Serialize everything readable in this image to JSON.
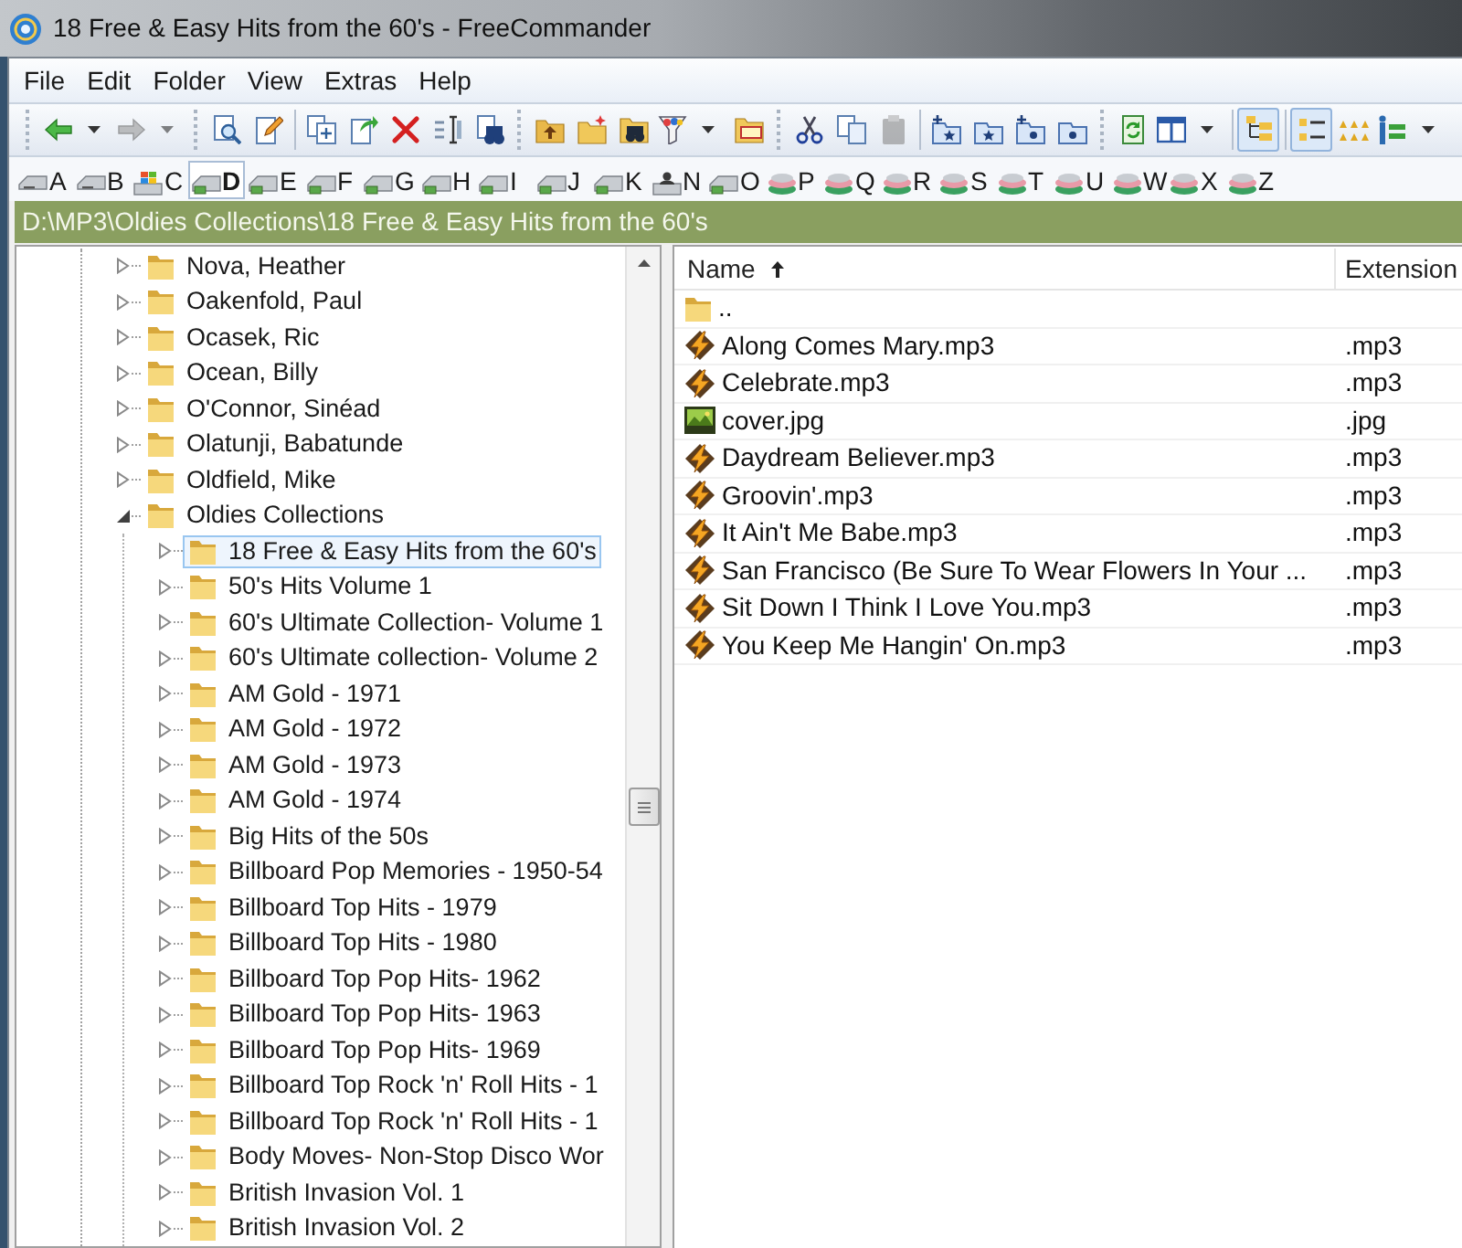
{
  "window": {
    "title": "18 Free & Easy Hits from the 60's - FreeCommander"
  },
  "menu": [
    "File",
    "Edit",
    "Folder",
    "View",
    "Extras",
    "Help"
  ],
  "toolbar": [
    {
      "pressed": false,
      "disabled": false
    },
    {
      "pressed": false,
      "disabled": true
    },
    {
      "pressed": false,
      "disabled": false
    },
    {
      "pressed": false,
      "disabled": false
    },
    {
      "pressed": false,
      "disabled": false
    },
    {
      "pressed": false,
      "disabled": false
    },
    {
      "pressed": false,
      "disabled": false
    },
    {
      "pressed": false,
      "disabled": false
    },
    {
      "pressed": false,
      "disabled": false
    },
    {
      "pressed": false,
      "disabled": false
    },
    {
      "pressed": false,
      "disabled": false
    },
    {
      "pressed": false,
      "disabled": false
    },
    {
      "pressed": false,
      "disabled": false
    },
    {
      "pressed": false,
      "disabled": false
    },
    {
      "pressed": false,
      "disabled": false
    },
    {
      "pressed": false,
      "disabled": false
    },
    {
      "pressed": false,
      "disabled": true
    },
    {
      "pressed": false,
      "disabled": false
    },
    {
      "pressed": false,
      "disabled": false
    },
    {
      "pressed": false,
      "disabled": false
    },
    {
      "pressed": false,
      "disabled": false
    },
    {
      "pressed": false,
      "disabled": false
    },
    {
      "pressed": false,
      "disabled": false
    },
    {
      "pressed": true,
      "disabled": false
    },
    {
      "pressed": true,
      "disabled": false
    },
    {
      "pressed": false,
      "disabled": false
    },
    {
      "pressed": false,
      "disabled": false
    }
  ],
  "drives": [
    {
      "letter": "A",
      "kind": "removable",
      "selected": false
    },
    {
      "letter": "B",
      "kind": "removable",
      "selected": false
    },
    {
      "letter": "C",
      "kind": "system",
      "selected": false
    },
    {
      "letter": "D",
      "kind": "disk",
      "selected": true
    },
    {
      "letter": "E",
      "kind": "disk",
      "selected": false
    },
    {
      "letter": "F",
      "kind": "disk",
      "selected": false
    },
    {
      "letter": "G",
      "kind": "disk",
      "selected": false
    },
    {
      "letter": "H",
      "kind": "disk",
      "selected": false
    },
    {
      "letter": "I",
      "kind": "disk",
      "selected": false
    },
    {
      "letter": "J",
      "kind": "disk",
      "selected": false
    },
    {
      "letter": "K",
      "kind": "disk",
      "selected": false
    },
    {
      "letter": "N",
      "kind": "shared",
      "selected": false
    },
    {
      "letter": "O",
      "kind": "disk",
      "selected": false
    },
    {
      "letter": "P",
      "kind": "network",
      "selected": false
    },
    {
      "letter": "Q",
      "kind": "network",
      "selected": false
    },
    {
      "letter": "R",
      "kind": "network",
      "selected": false
    },
    {
      "letter": "S",
      "kind": "network",
      "selected": false
    },
    {
      "letter": "T",
      "kind": "network",
      "selected": false
    },
    {
      "letter": "U",
      "kind": "network",
      "selected": false
    },
    {
      "letter": "W",
      "kind": "network",
      "selected": false
    },
    {
      "letter": "X",
      "kind": "network",
      "selected": false
    },
    {
      "letter": "Z",
      "kind": "network",
      "selected": false
    }
  ],
  "path": "D:\\MP3\\Oldies Collections\\18 Free & Easy Hits from the 60's",
  "tree": {
    "items": [
      {
        "label": "Nova, Heather",
        "expanded": false,
        "selected": false
      },
      {
        "label": "Oakenfold, Paul",
        "expanded": false,
        "selected": false
      },
      {
        "label": "Ocasek, Ric",
        "expanded": false,
        "selected": false
      },
      {
        "label": "Ocean, Billy",
        "expanded": false,
        "selected": false
      },
      {
        "label": "O'Connor, Sinéad",
        "expanded": false,
        "selected": false
      },
      {
        "label": "Olatunji, Babatunde",
        "expanded": false,
        "selected": false
      },
      {
        "label": "Oldfield, Mike",
        "expanded": false,
        "selected": false
      },
      {
        "label": "Oldies Collections",
        "expanded": true,
        "selected": false,
        "children": [
          {
            "label": "18 Free & Easy Hits from the 60's",
            "expanded": false,
            "selected": true
          },
          {
            "label": "50's Hits Volume 1",
            "expanded": false,
            "selected": false
          },
          {
            "label": "60's Ultimate Collection- Volume 1",
            "expanded": false,
            "selected": false
          },
          {
            "label": "60's Ultimate collection- Volume 2",
            "expanded": false,
            "selected": false
          },
          {
            "label": "AM Gold - 1971",
            "expanded": false,
            "selected": false
          },
          {
            "label": "AM Gold - 1972",
            "expanded": false,
            "selected": false
          },
          {
            "label": "AM Gold - 1973",
            "expanded": false,
            "selected": false
          },
          {
            "label": "AM Gold - 1974",
            "expanded": false,
            "selected": false
          },
          {
            "label": "Big Hits of the 50s",
            "expanded": false,
            "selected": false
          },
          {
            "label": "Billboard Pop Memories - 1950-54",
            "expanded": false,
            "selected": false
          },
          {
            "label": "Billboard Top Hits - 1979",
            "expanded": false,
            "selected": false
          },
          {
            "label": "Billboard Top Hits - 1980",
            "expanded": false,
            "selected": false
          },
          {
            "label": "Billboard Top Pop Hits- 1962",
            "expanded": false,
            "selected": false
          },
          {
            "label": "Billboard Top Pop Hits- 1963",
            "expanded": false,
            "selected": false
          },
          {
            "label": "Billboard Top Pop Hits- 1969",
            "expanded": false,
            "selected": false
          },
          {
            "label": "Billboard Top Rock 'n' Roll Hits - 1",
            "expanded": false,
            "selected": false
          },
          {
            "label": "Billboard Top Rock 'n' Roll Hits - 1",
            "expanded": false,
            "selected": false
          },
          {
            "label": "Body Moves- Non-Stop Disco Wor",
            "expanded": false,
            "selected": false
          },
          {
            "label": "British Invasion Vol. 1",
            "expanded": false,
            "selected": false
          },
          {
            "label": "British Invasion Vol. 2",
            "expanded": false,
            "selected": false
          }
        ]
      }
    ]
  },
  "files": {
    "columns": [
      {
        "label": "Name",
        "sorted": true
      },
      {
        "label": "Extension"
      }
    ],
    "rows": [
      {
        "name": "..",
        "kind": "folder"
      },
      {
        "name": "Along Comes Mary.mp3",
        "extension": ".mp3",
        "kind": "audio"
      },
      {
        "name": "Celebrate.mp3",
        "extension": ".mp3",
        "kind": "audio"
      },
      {
        "name": "cover.jpg",
        "extension": ".jpg",
        "kind": "image"
      },
      {
        "name": "Daydream Believer.mp3",
        "extension": ".mp3",
        "kind": "audio"
      },
      {
        "name": "Groovin'.mp3",
        "extension": ".mp3",
        "kind": "audio"
      },
      {
        "name": "It Ain't Me Babe.mp3",
        "extension": ".mp3",
        "kind": "audio"
      },
      {
        "name": "San Francisco (Be Sure To Wear Flowers In Your ...",
        "extension": ".mp3",
        "kind": "audio"
      },
      {
        "name": "Sit Down I Think I Love You.mp3",
        "extension": ".mp3",
        "kind": "audio"
      },
      {
        "name": "You Keep Me Hangin' On.mp3",
        "extension": ".mp3",
        "kind": "audio"
      }
    ]
  }
}
